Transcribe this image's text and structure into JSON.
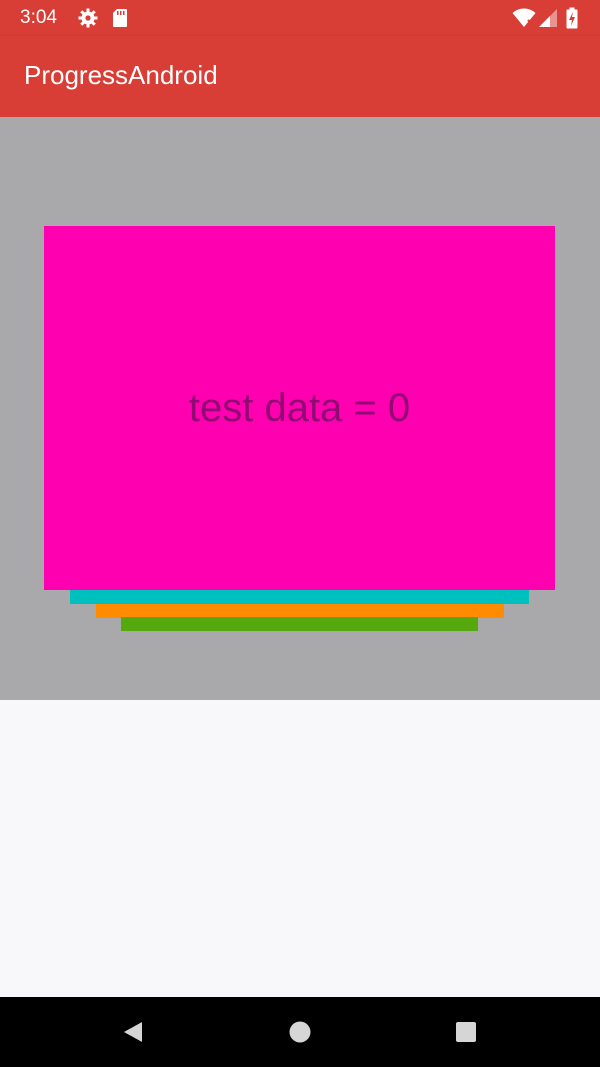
{
  "status_bar": {
    "time": "3:04",
    "icons": [
      "gear-icon",
      "sd-card-icon",
      "wifi-icon",
      "signal-icon",
      "battery-charging-icon"
    ]
  },
  "app_bar": {
    "title": "ProgressAndroid"
  },
  "content": {
    "card_text": "test data = 0"
  },
  "colors": {
    "primary": "#d83d36",
    "content_background": "#a9a8aa",
    "card": "#ff00b1",
    "card_text": "#8f0a73",
    "layer_1": "#00bfbf",
    "layer_2": "#ff8c00",
    "layer_3": "#55a80d",
    "navigation_bar": "#000000"
  },
  "navigation_bar": {
    "buttons": [
      "back-icon",
      "home-icon",
      "recents-icon"
    ]
  }
}
